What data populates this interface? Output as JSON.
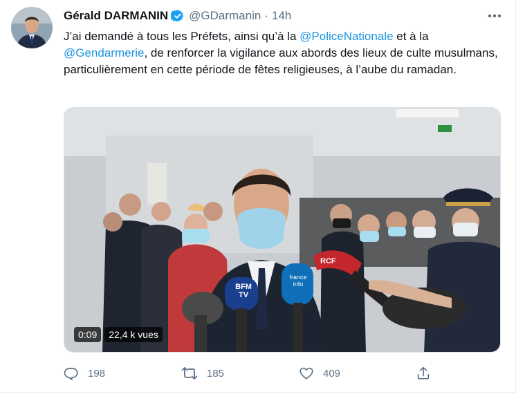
{
  "author": {
    "name": "Gérald DARMANIN",
    "handle": "@GDarmanin",
    "separator": "·",
    "time": "14h"
  },
  "tweet": {
    "text_1": "J’ai demandé à tous les Préfets, ainsi qu’à la ",
    "mention_1": "@PoliceNationale",
    "text_2": " et à la ",
    "mention_2": "@Gendarmerie",
    "text_3": ", de renforcer la vigilance aux abords des lieux de culte musulmans, particulièrement en cette période de fêtes religieuses, à l’aube du ramadan."
  },
  "media": {
    "duration": "0:09",
    "views": "22,4 k vues",
    "mic_labels": [
      "BFM TV",
      "france info",
      "RCF"
    ]
  },
  "actions": {
    "reply_count": "198",
    "retweet_count": "185",
    "like_count": "409"
  },
  "icons": {
    "verified": "verified-badge-icon",
    "more": "more-horizontal-icon",
    "reply": "reply-icon",
    "retweet": "retweet-icon",
    "like": "heart-icon",
    "share": "share-icon"
  },
  "colors": {
    "link": "#1b95e0",
    "secondary_text": "#5b7083",
    "verified": "#1da1f2"
  }
}
